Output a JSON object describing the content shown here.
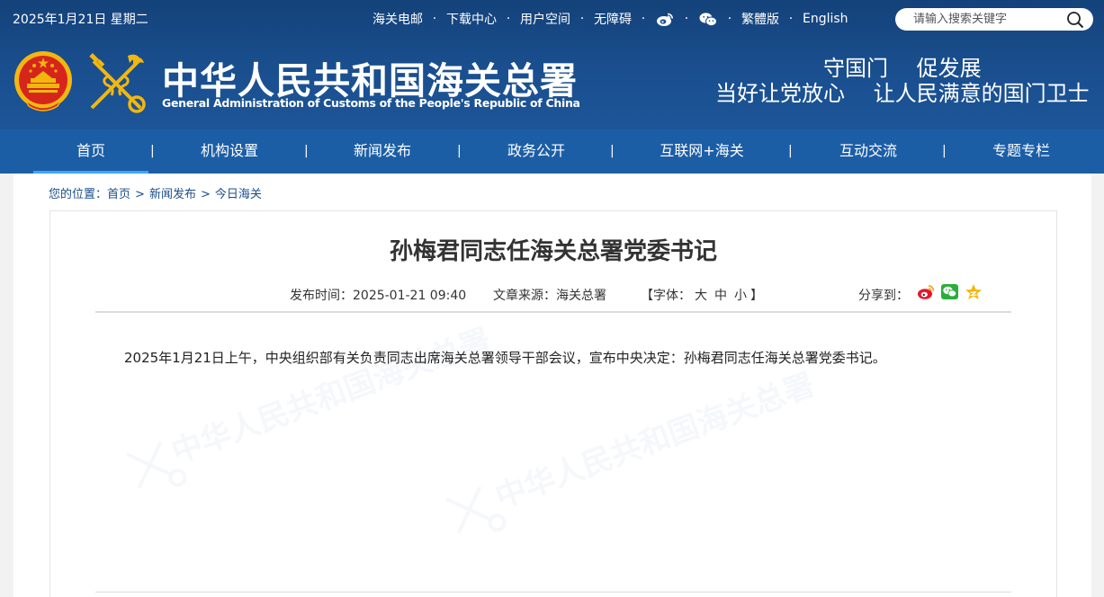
{
  "topbar": {
    "date": "2025年1月21日 星期二",
    "links": [
      "海关电邮",
      "下载中心",
      "用户空间",
      "无障碍"
    ],
    "weibo_icon": "weibo-icon",
    "wechat_icon": "wechat-icon",
    "traditional": "繁體版",
    "english": "English",
    "search_placeholder": "请输入搜索关键字"
  },
  "header": {
    "org_name_cn": "中华人民共和国海关总署",
    "org_name_en": "General Administration of Customs of the People's Republic of China",
    "slogan_line1": "守国门　 促发展",
    "slogan_line2": "当好让党放心　 让人民满意的国门卫士"
  },
  "nav": {
    "items": [
      "首页",
      "机构设置",
      "新闻发布",
      "政务公开",
      "互联网+海关",
      "互动交流",
      "专题专栏"
    ],
    "active": "首页",
    "separator": "|"
  },
  "breadcrumb": {
    "label": "您的位置：",
    "items": [
      "首页",
      "新闻发布",
      "今日海关"
    ],
    "separator": ">"
  },
  "article": {
    "title": "孙梅君同志任海关总署党委书记",
    "publish_label": "发布时间：",
    "publish_time": "2025-01-21 09:40",
    "source_label": "文章来源：",
    "source": "海关总署",
    "font_label": "【字体：",
    "font_large": "大",
    "font_medium": "中",
    "font_small": "小",
    "font_close": "】",
    "share_label": "分享到：",
    "body": "2025年1月21日上午，中央组织部有关负责同志出席海关总署领导干部会议，宣布中央决定：孙梅君同志任海关总署党委书记。"
  },
  "colors": {
    "header_bg": "#1a4f8f",
    "nav_bg": "#1c5ea6",
    "nav_active_underline": "#3ea6ff",
    "breadcrumb_text": "#1a4e8a"
  }
}
